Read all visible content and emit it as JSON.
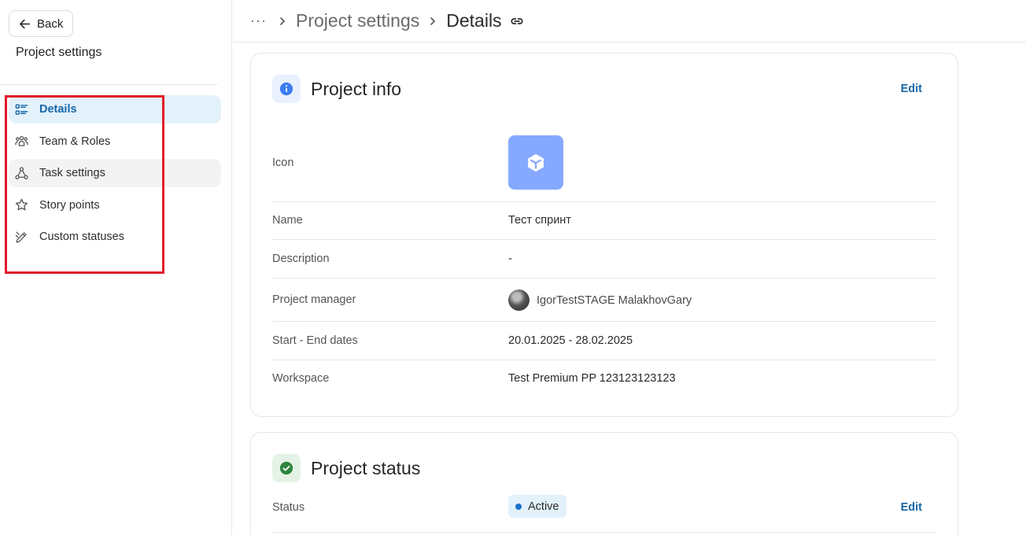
{
  "sidebar": {
    "back_label": "Back",
    "title": "Project settings",
    "items": [
      {
        "label": "Details",
        "icon": "list-details-icon",
        "active": true
      },
      {
        "label": "Team & Roles",
        "icon": "team-icon"
      },
      {
        "label": "Task settings",
        "icon": "workflow-icon"
      },
      {
        "label": "Story points",
        "icon": "star-icon"
      },
      {
        "label": "Custom statuses",
        "icon": "pencil-edit-icon"
      }
    ]
  },
  "breadcrumb": {
    "more": "···",
    "items": [
      "Project settings",
      "Details"
    ]
  },
  "project_info": {
    "title": "Project info",
    "edit_label": "Edit",
    "rows": {
      "icon_label": "Icon",
      "name_label": "Name",
      "name_value": "Тест спринт",
      "description_label": "Description",
      "description_value": "-",
      "manager_label": "Project manager",
      "manager_value": "IgorTestSTAGE MalakhovGary",
      "dates_label": "Start - End dates",
      "dates_value": "20.01.2025 - 28.02.2025",
      "workspace_label": "Workspace",
      "workspace_value": "Test Premium PP 123123123123"
    }
  },
  "project_status": {
    "title": "Project status",
    "status_label": "Status",
    "status_value": "Active",
    "edit_label": "Edit"
  },
  "colors": {
    "accent": "#1566a6",
    "active_nav_bg": "#e3f1fb",
    "project_icon_bg": "#85a9ff",
    "highlight": "#e3192a",
    "status_dot": "#1a73c9"
  }
}
